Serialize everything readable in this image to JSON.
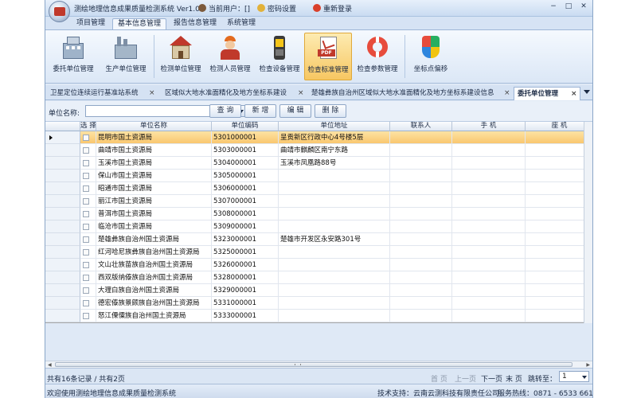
{
  "titlebar": {
    "title": "测绘地理信息成果质量检测系统 Ver1.0",
    "current_user_label": "当前用户：[]",
    "password_label": "密码设置",
    "relogin_label": "重新登录",
    "minimize": "−",
    "maximize": "□",
    "close": "✕"
  },
  "menu": {
    "tabs": [
      "项目管理",
      "基本信息管理",
      "报告信息管理",
      "系统管理"
    ],
    "active_tab": "基本信息管理"
  },
  "ribbon": {
    "buttons": [
      "委托单位管理",
      "生产单位管理",
      "检测单位管理",
      "检测人员管理",
      "检查设备管理",
      "检查标准管理",
      "检查参数管理",
      "坐标点偏移"
    ],
    "active_button": "检查标准管理",
    "pdf_badge": "PDF"
  },
  "doc_tabs": {
    "tabs": [
      "卫星定位连续运行基准站系统",
      "区域似大地水准面精化及地方坐标系建设",
      "楚雄彝族自治州区域似大地水准面精化及地方坐标系建设信息",
      "委托单位管理"
    ],
    "active_tab": "委托单位管理",
    "close_glyph": "×"
  },
  "search": {
    "label": "单位名称:",
    "value": "",
    "buttons": [
      "查 询",
      "新 增",
      "编 辑",
      "删 除"
    ]
  },
  "grid": {
    "columns": [
      "选 择",
      "单位名称",
      "单位编码",
      "单位地址",
      "联系人",
      "手 机",
      "座 机"
    ],
    "rows": [
      {
        "name": "昆明市国土资源局",
        "code": "5301000001",
        "address": "呈贡新区行政中心4号楼5层"
      },
      {
        "name": "曲靖市国土资源局",
        "code": "5303000001",
        "address": "曲靖市麒麟区南宁东路"
      },
      {
        "name": "玉溪市国土资源局",
        "code": "5304000001",
        "address": "玉溪市凤凰路88号"
      },
      {
        "name": "保山市国土资源局",
        "code": "5305000001",
        "address": ""
      },
      {
        "name": "昭通市国土资源局",
        "code": "5306000001",
        "address": ""
      },
      {
        "name": "丽江市国土资源局",
        "code": "5307000001",
        "address": ""
      },
      {
        "name": "普洱市国土资源局",
        "code": "5308000001",
        "address": ""
      },
      {
        "name": "临沧市国土资源局",
        "code": "5309000001",
        "address": ""
      },
      {
        "name": "楚雄彝族自治州国土资源局",
        "code": "5323000001",
        "address": "楚雄市开发区永安路301号"
      },
      {
        "name": "红河哈尼族彝族自治州国土资源局",
        "code": "5325000001",
        "address": ""
      },
      {
        "name": "文山壮族苗族自治州国土资源局",
        "code": "5326000001",
        "address": ""
      },
      {
        "name": "西双版纳傣族自治州国土资源局",
        "code": "5328000001",
        "address": ""
      },
      {
        "name": "大理白族自治州国土资源局",
        "code": "5329000001",
        "address": ""
      },
      {
        "name": "德宏傣族景颇族自治州国土资源局",
        "code": "5331000001",
        "address": ""
      },
      {
        "name": "怒江傈僳族自治州国土资源局",
        "code": "5333000001",
        "address": ""
      }
    ],
    "selected_row": 0
  },
  "pager": {
    "summary": "共有16条记录 / 共有2页",
    "first": "首 页",
    "prev": "上一页",
    "next": "下一页",
    "last": "末 页",
    "jump_label": "跳转至：",
    "current_page": "1"
  },
  "status": {
    "welcome": "欢迎使用测绘地理信息成果质量检测系统",
    "support": "技术支持：云南云测科技有限责任公司",
    "hotline": "服务热线：0871 - 6533 6616"
  },
  "colors": {
    "accent": "#f9c56b",
    "frame": "#dfe9f6"
  }
}
